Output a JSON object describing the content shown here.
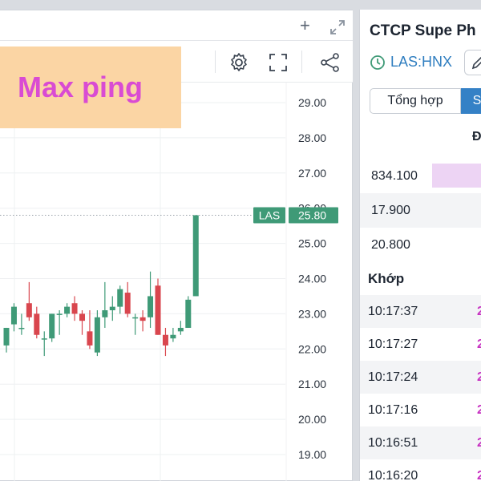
{
  "overlay": {
    "label": "Max ping"
  },
  "chart_data": {
    "type": "candlestick",
    "ticker_tag": "LAS",
    "last_price_label": "25.80",
    "last_price": 25.8,
    "ylim": [
      18.6,
      29.4
    ],
    "y_ticks": [
      "29.00",
      "28.00",
      "27.00",
      "26.00",
      "25.00",
      "24.00",
      "23.00",
      "22.00",
      "21.00",
      "20.00",
      "19.00"
    ],
    "y_tick_values": [
      29,
      28,
      27,
      26,
      25,
      24,
      23,
      22,
      21,
      20,
      19
    ],
    "up_color": "#3f9a77",
    "down_color": "#d9464e",
    "candles": [
      {
        "o": 22.1,
        "h": 22.6,
        "l": 21.9,
        "c": 22.6
      },
      {
        "o": 22.7,
        "h": 23.3,
        "l": 22.5,
        "c": 23.2
      },
      {
        "o": 22.6,
        "h": 23.0,
        "l": 22.4,
        "c": 22.6
      },
      {
        "o": 23.3,
        "h": 23.9,
        "l": 22.8,
        "c": 22.9
      },
      {
        "o": 23.0,
        "h": 23.2,
        "l": 22.3,
        "c": 22.4
      },
      {
        "o": 22.3,
        "h": 22.5,
        "l": 21.8,
        "c": 22.3
      },
      {
        "o": 22.3,
        "h": 23.0,
        "l": 22.2,
        "c": 23.0
      },
      {
        "o": 23.0,
        "h": 23.1,
        "l": 22.4,
        "c": 23.0
      },
      {
        "o": 23.0,
        "h": 23.3,
        "l": 22.9,
        "c": 23.2
      },
      {
        "o": 23.3,
        "h": 23.5,
        "l": 22.8,
        "c": 23.0
      },
      {
        "o": 23.0,
        "h": 23.1,
        "l": 22.4,
        "c": 22.8
      },
      {
        "o": 22.5,
        "h": 23.1,
        "l": 22.0,
        "c": 22.1
      },
      {
        "o": 21.9,
        "h": 23.1,
        "l": 21.8,
        "c": 22.9
      },
      {
        "o": 22.9,
        "h": 23.9,
        "l": 22.6,
        "c": 23.1
      },
      {
        "o": 23.1,
        "h": 23.5,
        "l": 22.8,
        "c": 23.2
      },
      {
        "o": 23.2,
        "h": 23.8,
        "l": 23.0,
        "c": 23.7
      },
      {
        "o": 23.6,
        "h": 23.9,
        "l": 22.9,
        "c": 23.0
      },
      {
        "o": 22.9,
        "h": 23.0,
        "l": 22.4,
        "c": 22.9
      },
      {
        "o": 22.9,
        "h": 23.1,
        "l": 22.5,
        "c": 22.8
      },
      {
        "o": 22.9,
        "h": 24.2,
        "l": 22.6,
        "c": 23.5
      },
      {
        "o": 23.8,
        "h": 24.0,
        "l": 22.4,
        "c": 22.4
      },
      {
        "o": 22.4,
        "h": 22.6,
        "l": 21.8,
        "c": 22.1
      },
      {
        "o": 22.3,
        "h": 22.6,
        "l": 22.2,
        "c": 22.4
      },
      {
        "o": 22.5,
        "h": 22.8,
        "l": 22.4,
        "c": 22.6
      },
      {
        "o": 22.6,
        "h": 23.5,
        "l": 22.6,
        "c": 23.4
      },
      {
        "o": 23.5,
        "h": 25.8,
        "l": 23.5,
        "c": 25.8
      }
    ]
  },
  "panel": {
    "company": "CTCP Supe Ph",
    "ticker": "LAS:HNX",
    "tab_summary": "Tổng hợp",
    "tab_second": "S",
    "col_head": "Đ",
    "volumes": [
      "834.100",
      "17.900",
      "20.800"
    ],
    "trades_title": "Khớp",
    "trades": [
      {
        "time": "10:17:37",
        "p": "2"
      },
      {
        "time": "10:17:27",
        "p": "2"
      },
      {
        "time": "10:17:24",
        "p": "2"
      },
      {
        "time": "10:17:16",
        "p": "2"
      },
      {
        "time": "10:16:51",
        "p": "2"
      },
      {
        "time": "10:16:20",
        "p": "2"
      }
    ]
  },
  "colors": {
    "accent": "#3581c6",
    "tag_green": "#3f9a77",
    "overlay_bg": "#fbd5a4",
    "overlay_text": "#d94bd3"
  }
}
